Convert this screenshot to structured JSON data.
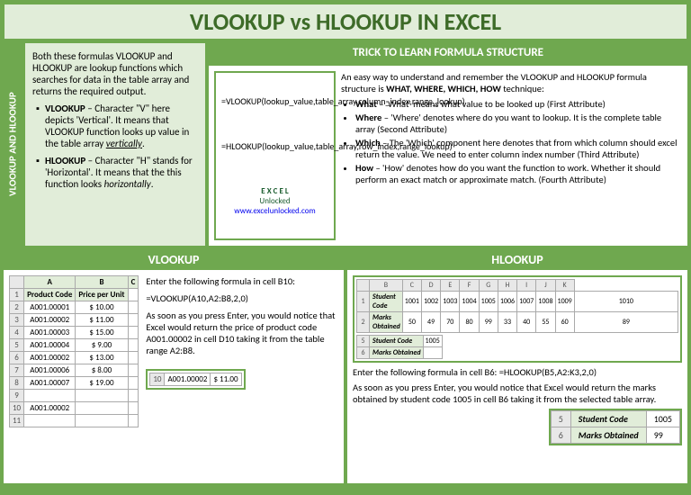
{
  "title": "VLOOKUP vs HLOOKUP IN EXCEL",
  "side": "VLOOKUP AND HLOOKUP",
  "intro": {
    "p": "Both these formulas VLOOKUP and HLOOKUP are lookup functions which searches for data in the table array and returns the required output.",
    "v": {
      "b": "VLOOKUP",
      "t": " – Character \"V\" here depicts 'Vertical'. It means that VLOOKUP function looks up value in the table array ",
      "i": "vertically"
    },
    "h": {
      "b": "HLOOKUP",
      "t": " – Character \"H\" stands for 'Horizontal'. It means that the this function looks ",
      "i": "horizontally"
    }
  },
  "trick": {
    "hdr": "TRICK TO LEARN FORMULA STRUCTURE",
    "s1": "=VLOOKUP(lookup_value,table_array,column_index,range_lookup)",
    "s2": "=HLOOKUP(lookup_value,table_array,row_index,range_lookup)",
    "logo1": "E X C E L",
    "logo2": "Unlocked",
    "url": "www.excelunlocked.com",
    "lead": "An easy way to understand and remember the VLOOKUP and HLOOKUP formula structure is ",
    "leadb": "WHAT, WHERE, WHICH, HOW",
    "lead2": " technique:",
    "w1": {
      "b": "What",
      "t": " – 'What' means what value to be looked up (First Attribute)"
    },
    "w2": {
      "b": "Where",
      "t": " – 'Where' denotes where do you want to lookup. It is the complete table array (Second Attribute)"
    },
    "w3": {
      "b": "Which",
      "t": " – The 'Which' component here denotes that from which column should excel return the value. We need to enter column index number (Third Attribute)"
    },
    "w4": {
      "b": "How",
      "t": " – 'How' denotes how do you want the function to work. Whether it should perform an exact match or approximate match. (Fourth Attribute)"
    }
  },
  "v": {
    "hdr": "VLOOKUP",
    "cols": {
      "a": "A",
      "b": "B",
      "c": "C",
      "h1": "Product Code",
      "h2": "Price per Unit"
    },
    "rows": [
      [
        "1",
        "",
        ""
      ],
      [
        "2",
        "A001.00001",
        "$   10.00"
      ],
      [
        "3",
        "A001.00002",
        "$   11.00"
      ],
      [
        "4",
        "A001.00003",
        "$   15.00"
      ],
      [
        "5",
        "A001.00004",
        "$     9.00"
      ],
      [
        "6",
        "A001.00002",
        "$   13.00"
      ],
      [
        "7",
        "A001.00006",
        "$     8.00"
      ],
      [
        "8",
        "A001.00007",
        "$   19.00"
      ],
      [
        "9",
        "",
        ""
      ],
      [
        "10",
        "A001.00002",
        ""
      ],
      [
        "11",
        "",
        ""
      ]
    ],
    "t1": "Enter the following formula in cell B10:",
    "f": "=VLOOKUP(A10,A2:B8,2,0)",
    "t2": "As soon as you press Enter, you would notice that Excel would return the price of product code A001.00002 in cell D10 taking it from the table range A2:B8.",
    "r": {
      "n": "10",
      "a": "A001.00002",
      "b": "$   11.00"
    }
  },
  "h": {
    "hdr": "HLOOKUP",
    "cols": [
      "",
      "B",
      "C",
      "D",
      "E",
      "F",
      "G",
      "H",
      "I",
      "J",
      "K"
    ],
    "r1": [
      "1",
      "Student Code",
      "1001",
      "1002",
      "1003",
      "1004",
      "1005",
      "1006",
      "1007",
      "1008",
      "1009",
      "1010"
    ],
    "r2": [
      "2",
      "Marks Obtained",
      "50",
      "49",
      "70",
      "80",
      "99",
      "33",
      "40",
      "55",
      "60",
      "89"
    ],
    "r3": [
      "5",
      "Student Code",
      "1005"
    ],
    "r4": [
      "6",
      "Marks Obtained",
      ""
    ],
    "t1": "Enter the following formula in cell B6: =HLOOKUP(B5,A2:K3,2,0)",
    "t2": "As soon as you press Enter, you would notice that Excel would return the marks obtained by student code 1005 in cell B6 taking it from the selected table array.",
    "res": [
      [
        "5",
        "Student Code",
        "1005"
      ],
      [
        "6",
        "Marks Obtained",
        "99"
      ]
    ]
  }
}
